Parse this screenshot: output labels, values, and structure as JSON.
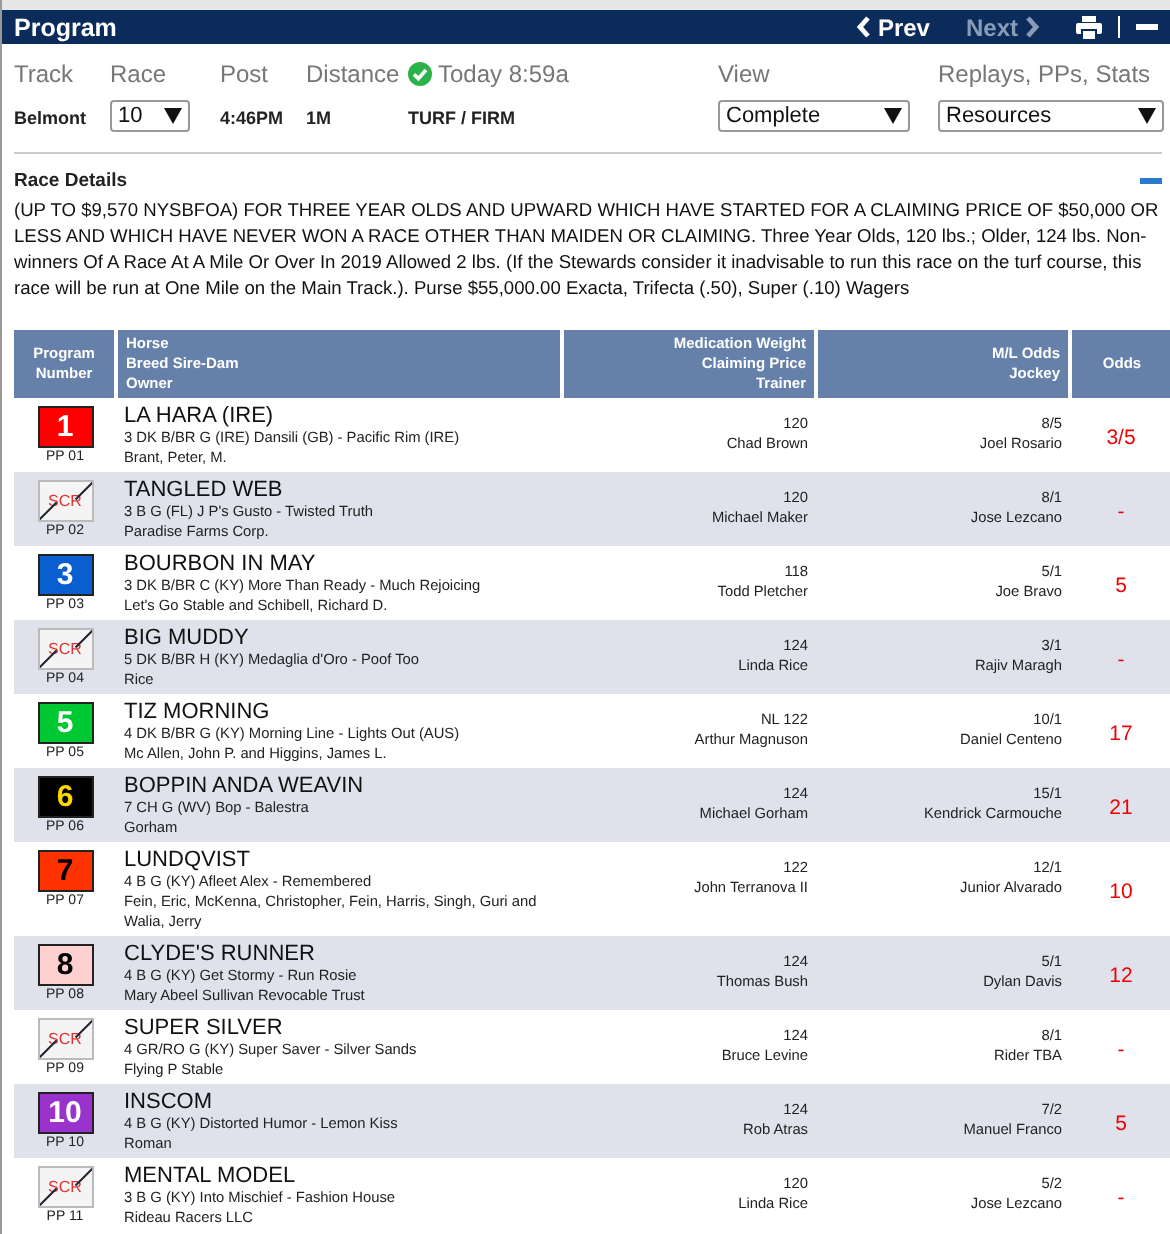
{
  "header": {
    "title": "Program",
    "prev": "Prev",
    "next": "Next",
    "next_disabled": true
  },
  "filters": {
    "track_label": "Track",
    "track": "Belmont",
    "race_label": "Race",
    "race": "10",
    "post_label": "Post",
    "post": "4:46PM",
    "distance_label": "Distance",
    "distance": "1M",
    "updated": "Today 8:59a",
    "surface": "TURF / FIRM",
    "view_label": "View",
    "view": "Complete",
    "resources_label": "Replays, PPs, Stats",
    "resources": "Resources"
  },
  "race_details": {
    "title": "Race Details",
    "expanded": true,
    "text": "(UP TO $9,570 NYSBFOA) FOR THREE YEAR OLDS AND UPWARD WHICH HAVE STARTED FOR A CLAIMING PRICE OF $50,000 OR LESS AND WHICH HAVE NEVER WON A RACE OTHER THAN MAIDEN OR CLAIMING. Three Year Olds, 120 lbs.; Older, 124 lbs. Non-winners Of A Race At A Mile Or Over In 2019 Allowed 2 lbs. (If the Stewards consider it inadvisable to run this race on the turf course, this race will be run at One Mile on the Main Track.). Purse $55,000.00 Exacta, Trifecta (.50), Super (.10) Wagers"
  },
  "table": {
    "columns": [
      [
        "Program",
        "Number"
      ],
      [
        "Horse",
        "Breed Sire-Dam",
        "Owner"
      ],
      [
        "Medication Weight",
        "Claiming Price",
        "Trainer"
      ],
      [
        "M/L Odds",
        "Jockey"
      ],
      [
        "Odds"
      ]
    ],
    "rows": [
      {
        "kind": "light",
        "number": "1",
        "color": "#ff0000",
        "pp": "PP 01",
        "horse": "LA HARA (IRE)",
        "breeding": "3 DK B/BR G (IRE) Dansili (GB) - Pacific Rim (IRE)",
        "owner": "Brant, Peter, M.",
        "weight": "120",
        "trainer": "Chad Brown",
        "ml_odds": "8/5",
        "jockey": "Joel Rosario",
        "odds": "3/5"
      },
      {
        "kind": "scratched",
        "number": "SCR",
        "pp": "PP 02",
        "horse": "TANGLED WEB",
        "breeding": "3 B G (FL) J P's Gusto - Twisted Truth",
        "owner": "Paradise Farms Corp.",
        "weight": "120",
        "trainer": "Michael Maker",
        "ml_odds": "8/1",
        "jockey": "Jose Lezcano",
        "odds": "-"
      },
      {
        "kind": "light",
        "number": "3",
        "color": "#0a5fd0",
        "pp": "PP 03",
        "horse": "BOURBON IN MAY",
        "breeding": "3 DK B/BR C (KY) More Than Ready - Much Rejoicing",
        "owner": "Let's Go Stable and Schibell, Richard D.",
        "weight": "118",
        "trainer": "Todd Pletcher",
        "ml_odds": "5/1",
        "jockey": "Joe Bravo",
        "odds": "5"
      },
      {
        "kind": "scratched",
        "number": "SCR",
        "pp": "PP 04",
        "horse": "BIG MUDDY",
        "breeding": "5 DK B/BR H (KY) Medaglia d'Oro - Poof Too",
        "owner": "Rice",
        "weight": "124",
        "trainer": "Linda Rice",
        "ml_odds": "3/1",
        "jockey": "Rajiv Maragh",
        "odds": "-"
      },
      {
        "kind": "light",
        "number": "5",
        "color": "#00c832",
        "pp": "PP 05",
        "horse": "TIZ MORNING",
        "breeding": "4 DK B/BR G (KY) Morning Line - Lights Out (AUS)",
        "owner": "Mc Allen, John P. and Higgins, James L.",
        "weight": "NL 122",
        "trainer": "Arthur Magnuson",
        "ml_odds": "10/1",
        "jockey": "Daniel Centeno",
        "odds": "17"
      },
      {
        "kind": "gold",
        "number": "6",
        "color": "#000000",
        "pp": "PP 06",
        "horse": "BOPPIN ANDA WEAVIN",
        "breeding": "7 CH G (WV) Bop - Balestra",
        "owner": "Gorham",
        "weight": "124",
        "trainer": "Michael Gorham",
        "ml_odds": "15/1",
        "jockey": "Kendrick Carmouche",
        "odds": "21"
      },
      {
        "kind": "dark",
        "number": "7",
        "color": "#ff3300",
        "pp": "PP 07",
        "horse": "LUNDQVIST",
        "breeding": "4 B G (KY) Afleet Alex - Remembered",
        "owner": "Fein, Eric, McKenna, Christopher, Fein, Harris, Singh, Guri and Walia, Jerry",
        "weight": "122",
        "trainer": "John Terranova II",
        "ml_odds": "12/1",
        "jockey": "Junior Alvarado",
        "odds": "10"
      },
      {
        "kind": "dark",
        "number": "8",
        "color": "#ffd0d0",
        "pp": "PP 08",
        "horse": "CLYDE'S RUNNER",
        "breeding": "4 B G (KY) Get Stormy - Run Rosie",
        "owner": "Mary Abeel Sullivan Revocable Trust",
        "weight": "124",
        "trainer": "Thomas Bush",
        "ml_odds": "5/1",
        "jockey": "Dylan Davis",
        "odds": "12"
      },
      {
        "kind": "scratched",
        "number": "SCR",
        "pp": "PP 09",
        "horse": "SUPER SILVER",
        "breeding": "4 GR/RO G (KY) Super Saver - Silver Sands",
        "owner": "Flying P Stable",
        "weight": "124",
        "trainer": "Bruce Levine",
        "ml_odds": "8/1",
        "jockey": "Rider TBA",
        "odds": "-"
      },
      {
        "kind": "light",
        "number": "10",
        "color": "#9933cc",
        "pp": "PP 10",
        "horse": "INSCOM",
        "breeding": "4 B G (KY) Distorted Humor - Lemon Kiss",
        "owner": "Roman",
        "weight": "124",
        "trainer": "Rob Atras",
        "ml_odds": "7/2",
        "jockey": "Manuel Franco",
        "odds": "5"
      },
      {
        "kind": "scratched",
        "number": "SCR",
        "pp": "PP 11",
        "horse": "MENTAL MODEL",
        "breeding": "3 B G (KY) Into Mischief - Fashion House",
        "owner": "Rideau Racers LLC",
        "weight": "120",
        "trainer": "Linda Rice",
        "ml_odds": "5/2",
        "jockey": "Jose Lezcano",
        "odds": "-"
      }
    ]
  }
}
